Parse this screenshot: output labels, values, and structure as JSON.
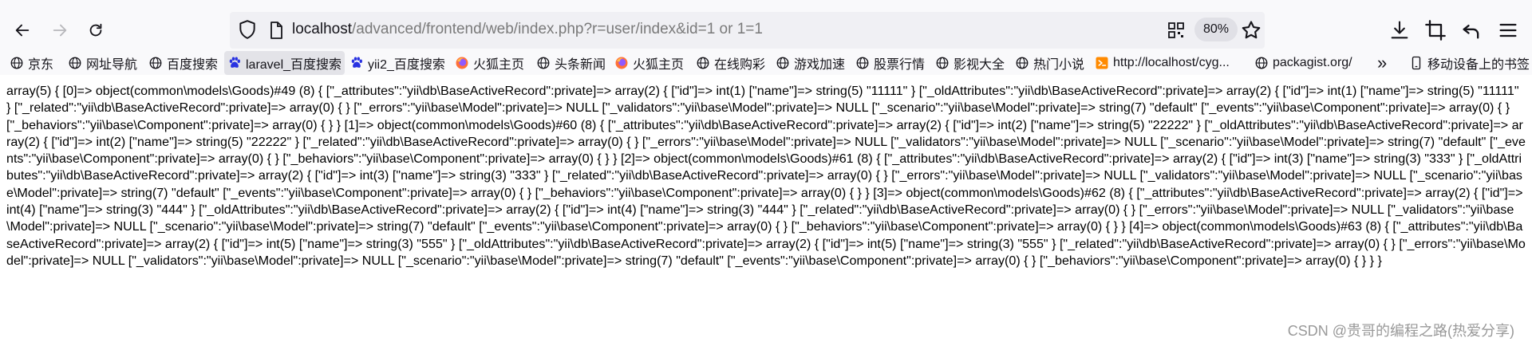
{
  "browser": {
    "url_host": "localhost",
    "url_path": "/advanced/frontend/web/index.php?r=user/index&id=1 or 1=1",
    "zoom": "80%"
  },
  "bookmarks": [
    {
      "label": "京东",
      "icon": "globe-icon"
    },
    {
      "label": "网址导航",
      "icon": "globe-icon"
    },
    {
      "label": "百度搜索",
      "icon": "globe-icon"
    },
    {
      "label": "laravel_百度搜索",
      "icon": "baidu-paw-icon",
      "active": true
    },
    {
      "label": "yii2_百度搜索",
      "icon": "baidu-paw-icon"
    },
    {
      "label": "火狐主页",
      "icon": "firefox-icon"
    },
    {
      "label": "头条新闻",
      "icon": "globe-icon"
    },
    {
      "label": "火狐主页",
      "icon": "firefox-icon"
    },
    {
      "label": "在线购彩",
      "icon": "globe-icon"
    },
    {
      "label": "游戏加速",
      "icon": "globe-icon"
    },
    {
      "label": "股票行情",
      "icon": "globe-icon"
    },
    {
      "label": "影视大全",
      "icon": "globe-icon"
    },
    {
      "label": "热门小说",
      "icon": "globe-icon"
    },
    {
      "label": "http://localhost/cyg...",
      "icon": "orange-site-icon"
    },
    {
      "label": "packagist.org/",
      "icon": "globe-icon"
    }
  ],
  "bookmarks_overflow_label": "»",
  "mobile_bookmarks_label": "移动设备上的书签",
  "page_output": "array(5) { [0]=> object(common\\models\\Goods)#49 (8) { [\"_attributes\":\"yii\\db\\BaseActiveRecord\":private]=> array(2) { [\"id\"]=> int(1) [\"name\"]=> string(5) \"11111\" } [\"_oldAttributes\":\"yii\\db\\BaseActiveRecord\":private]=> array(2) { [\"id\"]=> int(1) [\"name\"]=> string(5) \"11111\" } [\"_related\":\"yii\\db\\BaseActiveRecord\":private]=> array(0) { } [\"_errors\":\"yii\\base\\Model\":private]=> NULL [\"_validators\":\"yii\\base\\Model\":private]=> NULL [\"_scenario\":\"yii\\base\\Model\":private]=> string(7) \"default\" [\"_events\":\"yii\\base\\Component\":private]=> array(0) { } [\"_behaviors\":\"yii\\base\\Component\":private]=> array(0) { } } [1]=> object(common\\models\\Goods)#60 (8) { [\"_attributes\":\"yii\\db\\BaseActiveRecord\":private]=> array(2) { [\"id\"]=> int(2) [\"name\"]=> string(5) \"22222\" } [\"_oldAttributes\":\"yii\\db\\BaseActiveRecord\":private]=> array(2) { [\"id\"]=> int(2) [\"name\"]=> string(5) \"22222\" } [\"_related\":\"yii\\db\\BaseActiveRecord\":private]=> array(0) { } [\"_errors\":\"yii\\base\\Model\":private]=> NULL [\"_validators\":\"yii\\base\\Model\":private]=> NULL [\"_scenario\":\"yii\\base\\Model\":private]=> string(7) \"default\" [\"_events\":\"yii\\base\\Component\":private]=> array(0) { } [\"_behaviors\":\"yii\\base\\Component\":private]=> array(0) { } } [2]=> object(common\\models\\Goods)#61 (8) { [\"_attributes\":\"yii\\db\\BaseActiveRecord\":private]=> array(2) { [\"id\"]=> int(3) [\"name\"]=> string(3) \"333\" } [\"_oldAttributes\":\"yii\\db\\BaseActiveRecord\":private]=> array(2) { [\"id\"]=> int(3) [\"name\"]=> string(3) \"333\" } [\"_related\":\"yii\\db\\BaseActiveRecord\":private]=> array(0) { } [\"_errors\":\"yii\\base\\Model\":private]=> NULL [\"_validators\":\"yii\\base\\Model\":private]=> NULL [\"_scenario\":\"yii\\base\\Model\":private]=> string(7) \"default\" [\"_events\":\"yii\\base\\Component\":private]=> array(0) { } [\"_behaviors\":\"yii\\base\\Component\":private]=> array(0) { } } [3]=> object(common\\models\\Goods)#62 (8) { [\"_attributes\":\"yii\\db\\BaseActiveRecord\":private]=> array(2) { [\"id\"]=> int(4) [\"name\"]=> string(3) \"444\" } [\"_oldAttributes\":\"yii\\db\\BaseActiveRecord\":private]=> array(2) { [\"id\"]=> int(4) [\"name\"]=> string(3) \"444\" } [\"_related\":\"yii\\db\\BaseActiveRecord\":private]=> array(0) { } [\"_errors\":\"yii\\base\\Model\":private]=> NULL [\"_validators\":\"yii\\base\\Model\":private]=> NULL [\"_scenario\":\"yii\\base\\Model\":private]=> string(7) \"default\" [\"_events\":\"yii\\base\\Component\":private]=> array(0) { } [\"_behaviors\":\"yii\\base\\Component\":private]=> array(0) { } } [4]=> object(common\\models\\Goods)#63 (8) { [\"_attributes\":\"yii\\db\\BaseActiveRecord\":private]=> array(2) { [\"id\"]=> int(5) [\"name\"]=> string(3) \"555\" } [\"_oldAttributes\":\"yii\\db\\BaseActiveRecord\":private]=> array(2) { [\"id\"]=> int(5) [\"name\"]=> string(3) \"555\" } [\"_related\":\"yii\\db\\BaseActiveRecord\":private]=> array(0) { } [\"_errors\":\"yii\\base\\Model\":private]=> NULL [\"_validators\":\"yii\\base\\Model\":private]=> NULL [\"_scenario\":\"yii\\base\\Model\":private]=> string(7) \"default\" [\"_events\":\"yii\\base\\Component\":private]=> array(0) { } [\"_behaviors\":\"yii\\base\\Component\":private]=> array(0) { } } }",
  "watermark": "CSDN @贵哥的编程之路(热爱分享)"
}
